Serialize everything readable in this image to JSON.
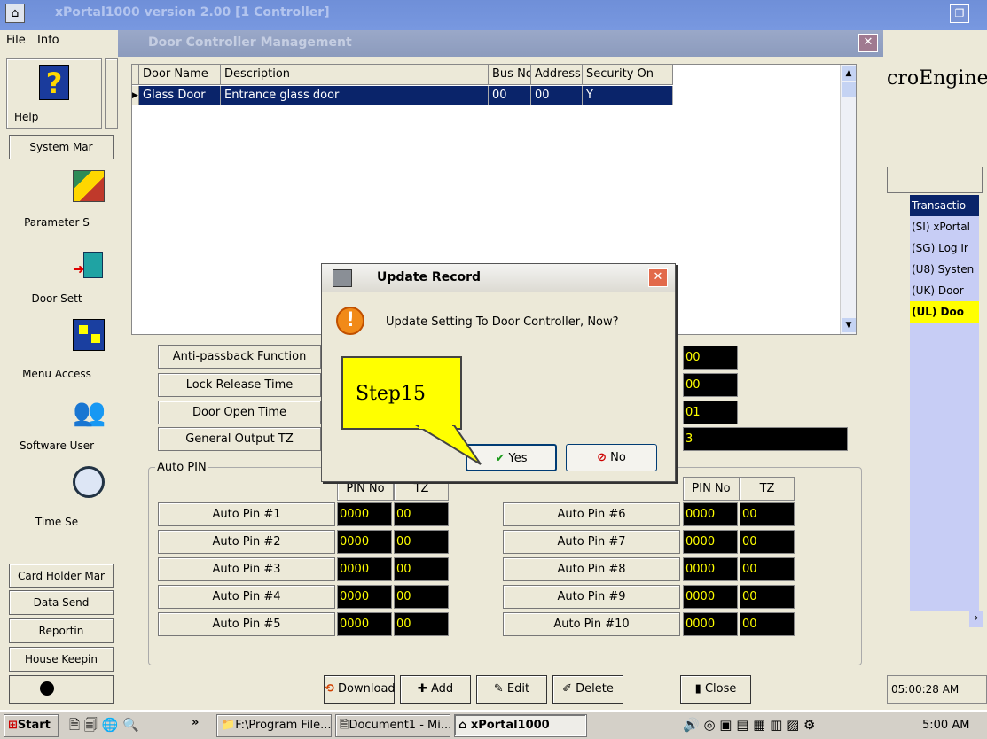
{
  "app": {
    "title": "xPortal1000 version 2.00 [1 Controller]",
    "menu": [
      "File",
      "Info"
    ],
    "help_label": "Help",
    "brand_text": "croEngine",
    "tm": "™"
  },
  "left_panel": {
    "system_btn": "System Mar",
    "items": [
      "Parameter S",
      "Door Sett",
      "Menu Access",
      "Software User",
      "Time Se"
    ],
    "bottom_buttons": [
      "Card Holder Mar",
      "Data Send",
      "Reportin",
      "House Keepin"
    ]
  },
  "right_panel": {
    "header": "Transactio",
    "items": [
      "(SI) xPortal",
      "(SG) Log Ir",
      "(U8) Systen",
      "(UK) Door",
      "(UL) Doo"
    ],
    "time": "05:00:28 AM"
  },
  "dcm": {
    "title": "Door Controller Management",
    "grid_headers": [
      "Door Name",
      "Description",
      "Bus No",
      "Address",
      "Security On"
    ],
    "grid_row": [
      "Glass Door",
      "Entrance glass door",
      "00",
      "00",
      "Y"
    ],
    "fields": [
      {
        "label": "Anti-passback Function",
        "value": "00"
      },
      {
        "label": "Lock Release Time",
        "value": "00"
      },
      {
        "label": "Door Open Time",
        "value": "01"
      },
      {
        "label": "General Output TZ",
        "value": "3"
      }
    ],
    "auto_pin_legend": "Auto PIN",
    "col_pin": "PIN No",
    "col_tz": "TZ",
    "pins_left": [
      {
        "label": "Auto Pin #1",
        "pin": "0000",
        "tz": "00"
      },
      {
        "label": "Auto Pin #2",
        "pin": "0000",
        "tz": "00"
      },
      {
        "label": "Auto Pin #3",
        "pin": "0000",
        "tz": "00"
      },
      {
        "label": "Auto Pin #4",
        "pin": "0000",
        "tz": "00"
      },
      {
        "label": "Auto Pin #5",
        "pin": "0000",
        "tz": "00"
      }
    ],
    "pins_right": [
      {
        "label": "Auto Pin #6",
        "pin": "0000",
        "tz": "00"
      },
      {
        "label": "Auto Pin #7",
        "pin": "0000",
        "tz": "00"
      },
      {
        "label": "Auto Pin #8",
        "pin": "0000",
        "tz": "00"
      },
      {
        "label": "Auto Pin #9",
        "pin": "0000",
        "tz": "00"
      },
      {
        "label": "Auto Pin #10",
        "pin": "0000",
        "tz": "00"
      }
    ],
    "buttons": {
      "download": "Download",
      "add": "Add",
      "edit": "Edit",
      "delete": "Delete",
      "close": "Close"
    }
  },
  "modal": {
    "title": "Update Record",
    "message": "Update Setting To Door Controller, Now?",
    "yes": "Yes",
    "no": "No"
  },
  "callout": {
    "text": "Step15"
  },
  "taskbar": {
    "start": "Start",
    "tasks": [
      "F:\\Program File...",
      "Document1 - Mi...",
      "xPortal1000"
    ],
    "clock": "5:00 AM",
    "chevron": "»"
  }
}
